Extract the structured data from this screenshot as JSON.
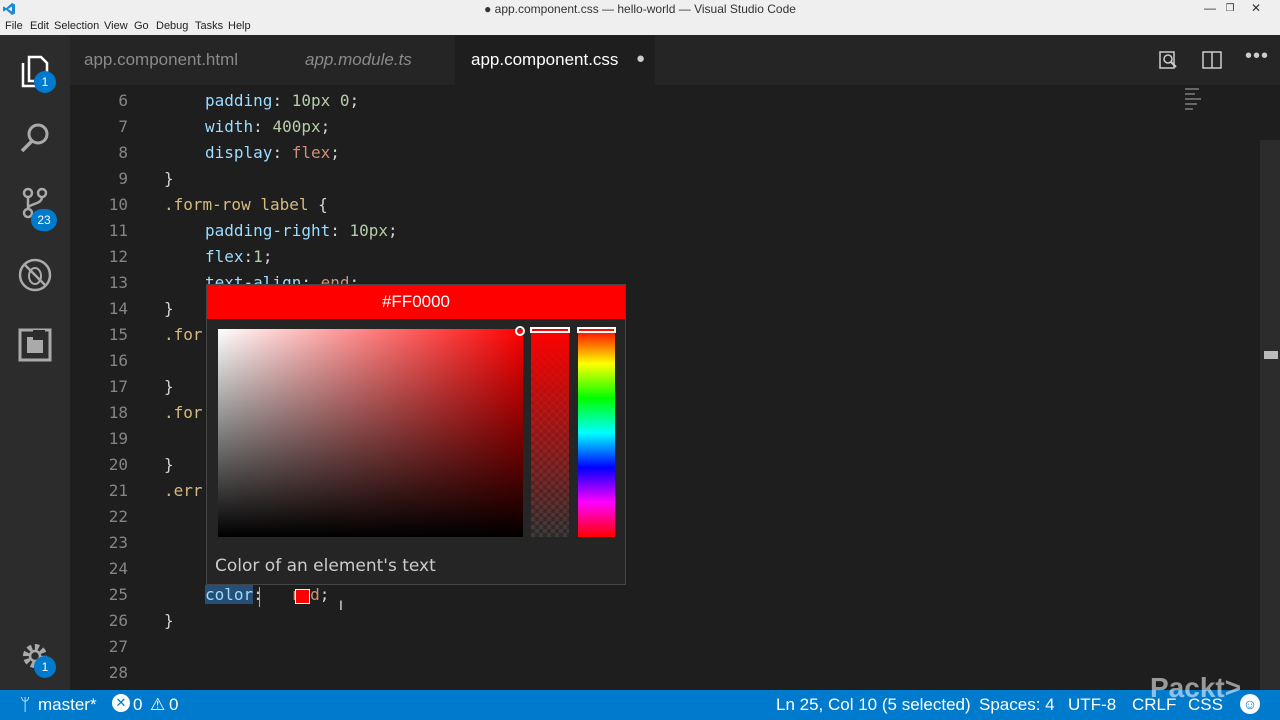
{
  "window": {
    "title": "● app.component.css — hello-world — Visual Studio Code"
  },
  "menu": [
    "File",
    "Edit",
    "Selection",
    "View",
    "Go",
    "Debug",
    "Tasks",
    "Help"
  ],
  "activity": {
    "explorer_badge": "1",
    "scm_badge": "23",
    "settings_badge": "1"
  },
  "tabs": [
    {
      "label": "app.component.html"
    },
    {
      "label": "app.module.ts"
    },
    {
      "label": "app.component.css",
      "dirty": "●"
    }
  ],
  "editor": {
    "line_numbers": [
      "6",
      "7",
      "8",
      "9",
      "10",
      "11",
      "12",
      "13",
      "14",
      "15",
      "16",
      "17",
      "18",
      "19",
      "20",
      "21",
      "22",
      "23",
      "24",
      "25",
      "26",
      "27",
      "28"
    ],
    "lines": {
      "l6": [
        "padding",
        ": ",
        "10px 0",
        ";"
      ],
      "l7": [
        "width",
        ": ",
        "400px",
        ";"
      ],
      "l8": [
        "display",
        ": ",
        "flex",
        ";"
      ],
      "l9": "}",
      "l10": [
        ".form-row label",
        " {"
      ],
      "l11": [
        "padding-right",
        ": ",
        "10px",
        ";"
      ],
      "l12": [
        "flex",
        ":",
        "1",
        ";"
      ],
      "l13": [
        "text-align",
        ": ",
        "end",
        ";"
      ],
      "l14": "}",
      "l15": ".for",
      "l17": "}",
      "l18": ".for",
      "l20": "}",
      "l21": ".err",
      "l25": [
        "color",
        ":",
        "red",
        ";"
      ],
      "l26": "}"
    }
  },
  "color_picker": {
    "hex": "#FF0000",
    "description": "Color of an element's text",
    "color": "#ff0000"
  },
  "statusbar": {
    "branch": "master*",
    "errors": "0",
    "warnings": "0",
    "position": "Ln 25, Col 10 (5 selected)",
    "spaces": "Spaces: 4",
    "encoding": "UTF-8",
    "eol": "CRLF",
    "language": "CSS",
    "watermark": "Packt>"
  }
}
